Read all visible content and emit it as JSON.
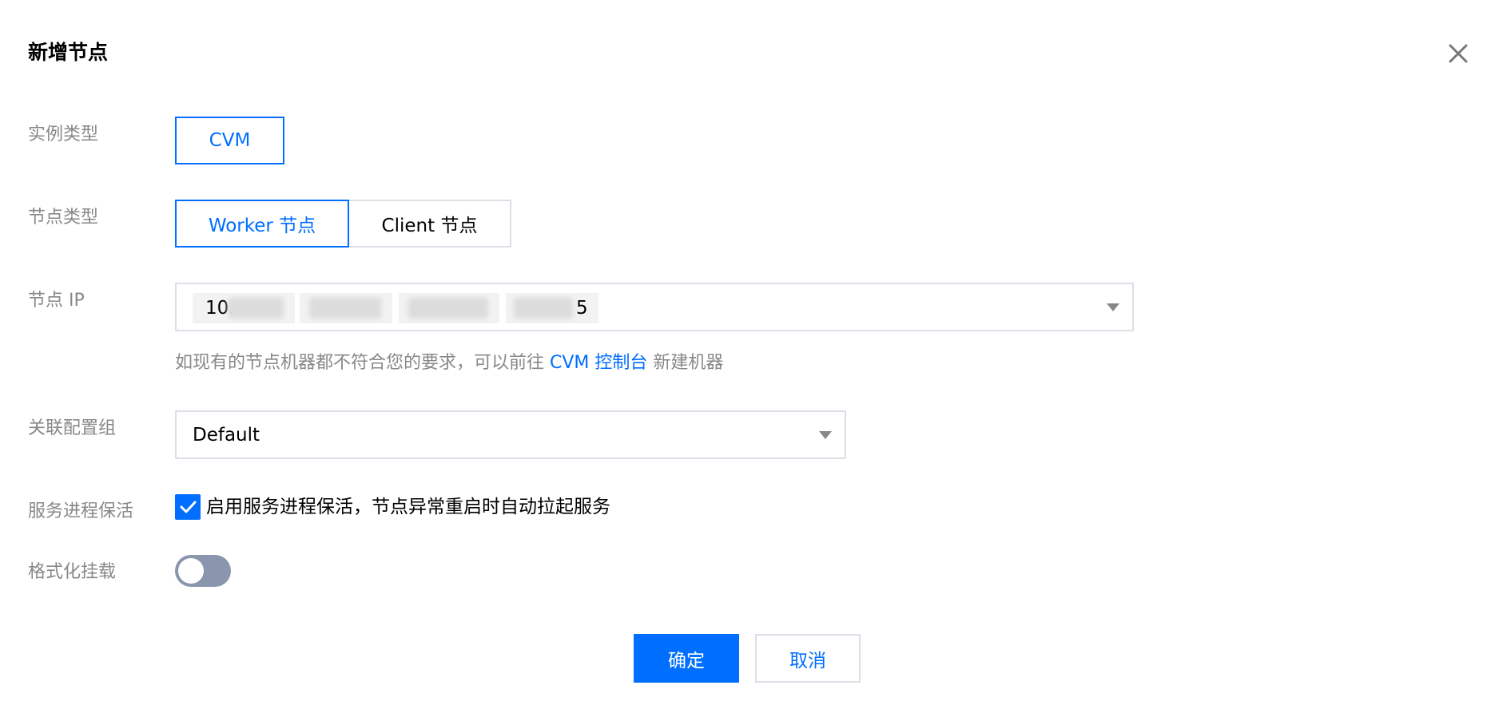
{
  "dialog": {
    "title": "新增节点"
  },
  "form": {
    "instance_type": {
      "label": "实例类型",
      "options": [
        "CVM"
      ],
      "selected": "CVM"
    },
    "node_type": {
      "label": "节点类型",
      "options": [
        "Worker 节点",
        "Client 节点"
      ],
      "selected": "Worker 节点"
    },
    "node_ip": {
      "label": "节点 IP",
      "tags": [
        "10.",
        "",
        "",
        "5"
      ],
      "hint_prefix": "如现有的节点机器都不符合您的要求，可以前往",
      "hint_link": "CVM 控制台",
      "hint_suffix": "新建机器"
    },
    "config_group": {
      "label": "关联配置组",
      "value": "Default"
    },
    "keepalive": {
      "label": "服务进程保活",
      "checked": true,
      "text": "启用服务进程保活，节点异常重启时自动拉起服务"
    },
    "format_mount": {
      "label": "格式化挂载",
      "enabled": false
    }
  },
  "footer": {
    "confirm_label": "确定",
    "cancel_label": "取消"
  },
  "colors": {
    "accent": "#006eff",
    "label_gray": "#888888",
    "border": "#dcdfe6",
    "toggle_off": "#8a96ad"
  }
}
